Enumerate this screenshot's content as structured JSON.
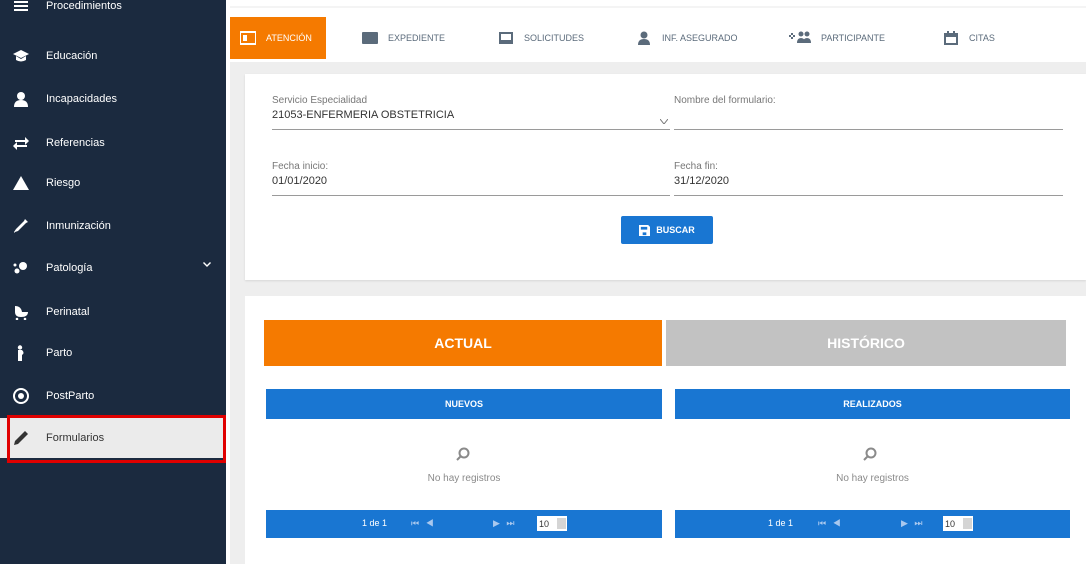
{
  "sidebar": {
    "items": [
      {
        "label": "Procedimientos",
        "icon": "list-icon"
      },
      {
        "label": "Educación",
        "icon": "graduation-cap-icon"
      },
      {
        "label": "Incapacidades",
        "icon": "user-icon"
      },
      {
        "label": "Referencias",
        "icon": "exchange-icon"
      },
      {
        "label": "Riesgo",
        "icon": "warning-icon"
      },
      {
        "label": "Inmunización",
        "icon": "syringe-icon"
      },
      {
        "label": "Patología",
        "icon": "virus-icon"
      },
      {
        "label": "Perinatal",
        "icon": "baby-carriage-icon"
      },
      {
        "label": "Parto",
        "icon": "pregnant-icon"
      },
      {
        "label": "PostParto",
        "icon": "circle-face-icon"
      },
      {
        "label": "Formularios",
        "icon": "pencil-icon"
      }
    ],
    "active_item": "Formularios"
  },
  "tabs": [
    {
      "label": "ATENCIÓN",
      "icon": "id-card-icon",
      "active": true
    },
    {
      "label": "EXPEDIENTE",
      "icon": "address-card-icon"
    },
    {
      "label": "SOLICITUDES",
      "icon": "inbox-icon"
    },
    {
      "label": "INF. ASEGURADO",
      "icon": "user-icon"
    },
    {
      "label": "PARTICIPANTE",
      "icon": "users-plus-icon"
    },
    {
      "label": "CITAS",
      "icon": "calendar-icon"
    }
  ],
  "filters": {
    "servicio_label": "Servicio Especialidad",
    "servicio_value": "21053-ENFERMERIA OBSTETRICIA",
    "formulario_label": "Nombre del formulario:",
    "formulario_value": "",
    "fecha_inicio_label": "Fecha inicio:",
    "fecha_inicio_value": "01/01/2020",
    "fecha_fin_label": "Fecha fin:",
    "fecha_fin_value": "31/12/2020",
    "buscar_label": "BUSCAR"
  },
  "results": {
    "actual_label": "ACTUAL",
    "historico_label": "HISTÓRICO",
    "panels": [
      {
        "title": "NUEVOS",
        "empty": "No hay registros",
        "page_info": "1 de 1",
        "page_size": "10"
      },
      {
        "title": "REALIZADOS",
        "empty": "No hay registros",
        "page_info": "1 de 1",
        "page_size": "10"
      }
    ]
  },
  "colors": {
    "sidebar_bg": "#1b2a3f",
    "accent_orange": "#f57a00",
    "primary_blue": "#1976d2",
    "inactive_gray": "#c2c2c2",
    "highlight_red": "#e00000"
  }
}
